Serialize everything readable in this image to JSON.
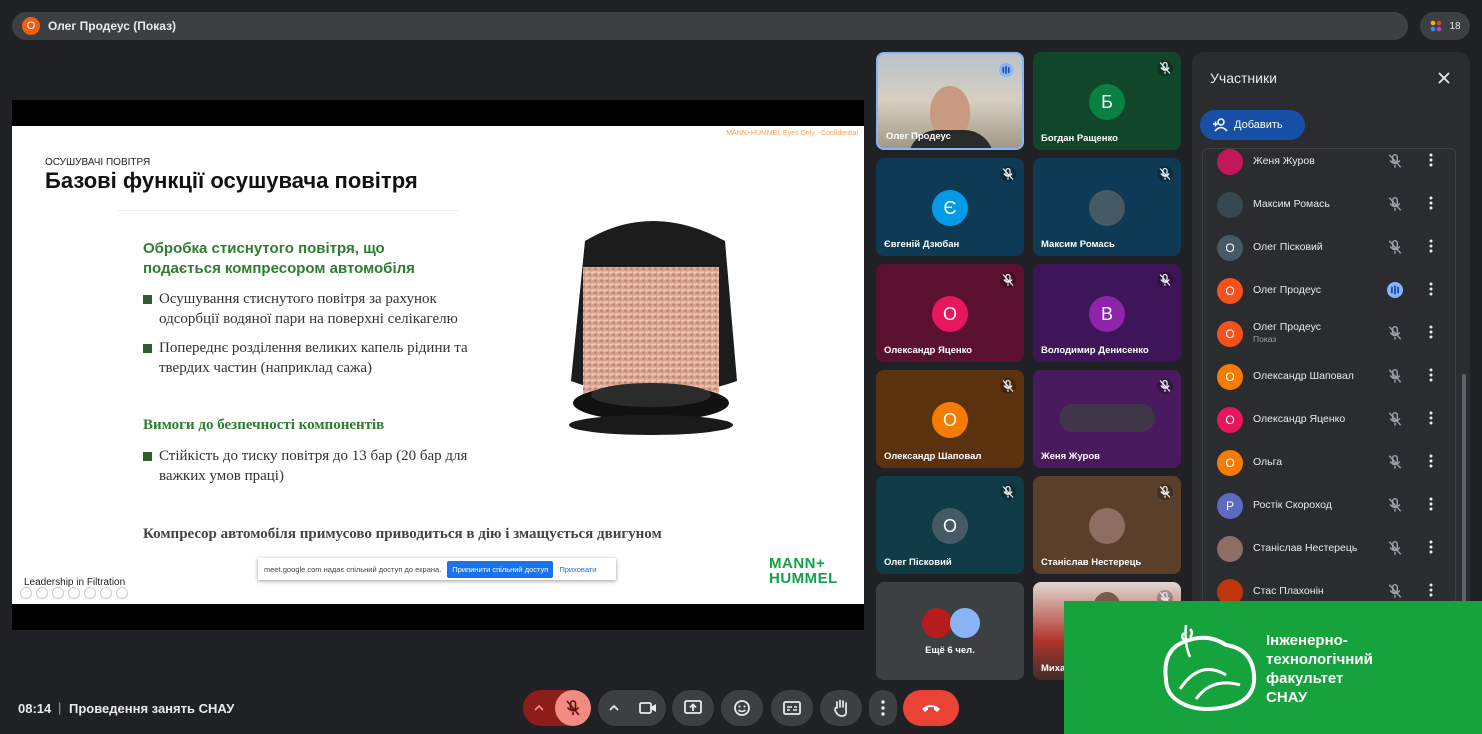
{
  "topbar": {
    "presenter_initial": "О",
    "presenter_label": "Олег Продеус (Показ)",
    "participants_count": "18"
  },
  "slide": {
    "confidential": "MANN+HUMMEL Eyes Only - Confidential",
    "section": "ОСУШУВАЧІ ПОВІТРЯ",
    "title": "Базові функції осушувача повітря",
    "heading1_line1": "Обробка стиснутого повітря, що",
    "heading1_line2": "подається компресором автомобіля",
    "bullet1_line1": "Осушування стиснутого повітря за рахунок",
    "bullet1_line2": "одсорбції водяної пари на поверхні селікагелю",
    "bullet2_line1": "Попереднє розділення великих капель рідини та",
    "bullet2_line2": "твердих частин (наприклад сажа)",
    "heading2": "Вимоги до безпечності компонентів",
    "bullet3_line1": "Стійкість до тиску повітря до 13 бар (20 бар для",
    "bullet3_line2": "важких умов праці)",
    "footer": "Компресор автомобіля примусово приводиться в дію і змащується двигуном",
    "leadership": "Leadership in Filtration",
    "brand_line1": "MANN+",
    "brand_line2": "HUMMEL"
  },
  "share_bar": {
    "message": "meet.google.com надає спільний доступ до екрана.",
    "stop_label": "Припинити спільний доступ",
    "hide_label": "Приховати"
  },
  "tiles": [
    {
      "name": "Олег Продеус",
      "initial": "",
      "color": "#6d7a86",
      "mic": "speaking"
    },
    {
      "name": "Богдан Ращенко",
      "initial": "Б",
      "color": "#0b8043",
      "bg": "#12462a",
      "mic": "muted"
    },
    {
      "name": "Євгеній Дзюбан",
      "initial": "Є",
      "color": "#039be5",
      "bg": "#0e3a55",
      "mic": "muted"
    },
    {
      "name": "Максим Ромась",
      "initial": "",
      "color": "#455a64",
      "bg": "#0e3a55",
      "mic": "muted"
    },
    {
      "name": "Олександр Яценко",
      "initial": "О",
      "color": "#e8175d",
      "bg": "#5c1030",
      "mic": "muted"
    },
    {
      "name": "Володимир Денисенко",
      "initial": "В",
      "color": "#8e24aa",
      "bg": "#3f1559",
      "mic": "muted"
    },
    {
      "name": "Олександр Шаповал",
      "initial": "О",
      "color": "#f57c00",
      "bg": "#5a320d",
      "mic": "muted"
    },
    {
      "name": "Женя Журов",
      "initial": "",
      "color": "#8e24aa",
      "bg": "#4a1a5e",
      "mic": "muted"
    },
    {
      "name": "Олег Пісковий",
      "initial": "О",
      "color": "#455a64",
      "bg": "#103c47",
      "mic": "muted"
    },
    {
      "name": "Станіслав Нестерець",
      "initial": "",
      "color": "#8d6e63",
      "bg": "#5a3f2a",
      "mic": "muted"
    },
    {
      "name": "Ещё 6 чел.",
      "initial": "",
      "color": "#3c4043",
      "bg": "#3c4043",
      "mic": "none"
    },
    {
      "name": "Миха",
      "initial": "",
      "color": "#6d4c41",
      "bg": "#7a5a4a",
      "mic": "muted"
    }
  ],
  "panel": {
    "title": "Участники",
    "add_label": "Добавить",
    "participants": [
      {
        "name": "Женя Журов",
        "initial": "",
        "color": "#c2185b",
        "sub": "",
        "mic": "muted"
      },
      {
        "name": "Максим Ромась",
        "initial": "",
        "color": "#37474f",
        "sub": "",
        "mic": "muted"
      },
      {
        "name": "Олег Пісковий",
        "initial": "О",
        "color": "#455a64",
        "sub": "",
        "mic": "muted"
      },
      {
        "name": "Олег Продеус",
        "initial": "О",
        "color": "#f4511e",
        "sub": "",
        "mic": "speaking"
      },
      {
        "name": "Олег Продеус",
        "initial": "О",
        "color": "#f4511e",
        "sub": "Показ",
        "mic": "muted-present"
      },
      {
        "name": "Олександр Шаповал",
        "initial": "О",
        "color": "#f57c00",
        "sub": "",
        "mic": "muted"
      },
      {
        "name": "Олександр Яценко",
        "initial": "О",
        "color": "#e8175d",
        "sub": "",
        "mic": "muted"
      },
      {
        "name": "Ольга",
        "initial": "О",
        "color": "#f57c00",
        "sub": "",
        "mic": "muted"
      },
      {
        "name": "Ростік Скороход",
        "initial": "Р",
        "color": "#5c6bc0",
        "sub": "",
        "mic": "muted"
      },
      {
        "name": "Станіслав Нестерець",
        "initial": "",
        "color": "#8d6e63",
        "sub": "",
        "mic": "muted"
      },
      {
        "name": "Стас Плахонін",
        "initial": "",
        "color": "#bf360c",
        "sub": "",
        "mic": "muted"
      }
    ]
  },
  "faculty_logo": {
    "line1": "Інженерно-",
    "line2": "технологічний",
    "line3": "факультет",
    "line4": "СНАУ"
  },
  "bottom": {
    "time": "08:14",
    "separator": "|",
    "meeting_name": "Проведення занять СНАУ"
  },
  "colors": {
    "background": "#202124",
    "end_call": "#ea4335",
    "mic_muted_bg": "#f28b82",
    "logo_green": "#16a23c"
  }
}
